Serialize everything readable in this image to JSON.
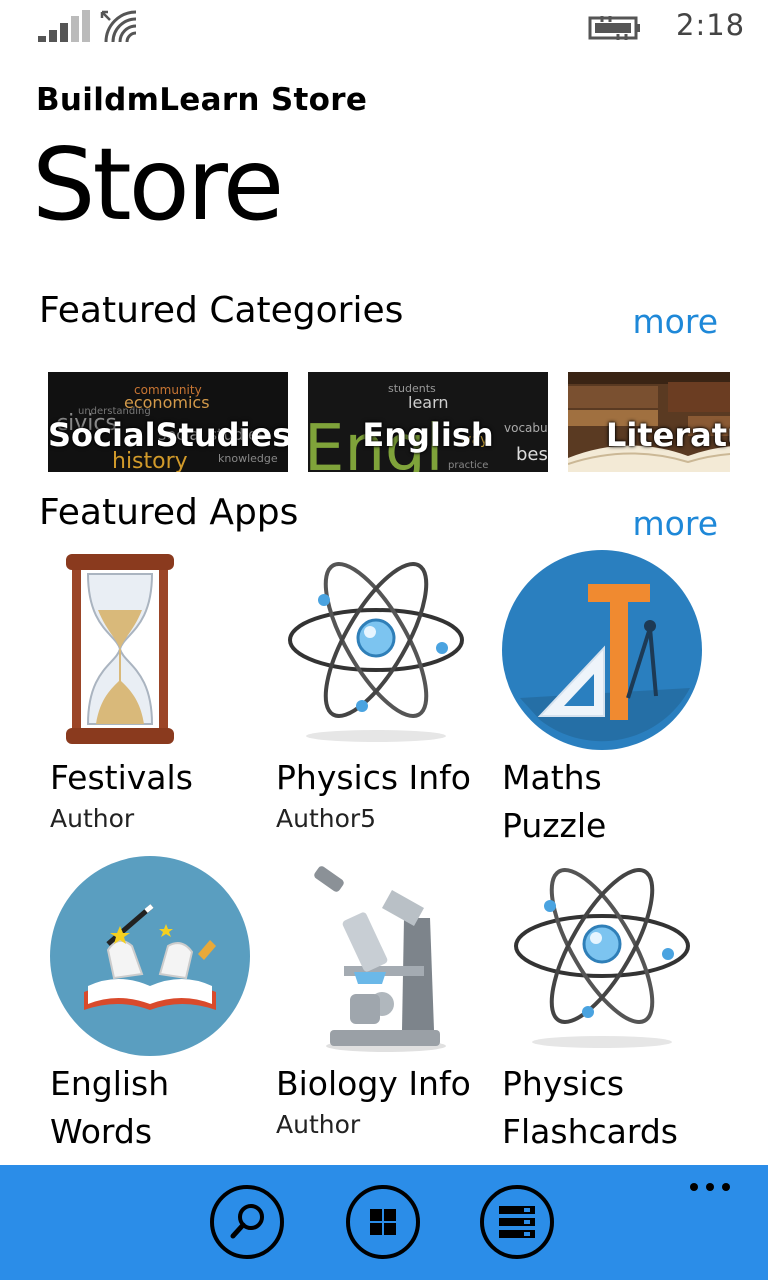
{
  "status_bar": {
    "time": "2:18",
    "icons": [
      "signal-icon",
      "wifi-icon",
      "battery-charging-icon"
    ]
  },
  "header": {
    "app_title": "BuildmLearn Store",
    "page_title": "Store"
  },
  "featured_categories": {
    "title": "Featured Categories",
    "more": "more",
    "items": [
      {
        "label": "SocialStudies"
      },
      {
        "label": "English"
      },
      {
        "label": "Literatu"
      }
    ]
  },
  "featured_apps": {
    "title": "Featured Apps",
    "more": "more",
    "items": [
      {
        "name": "Festivals",
        "author": "Author",
        "icon": "hourglass-icon"
      },
      {
        "name": "Physics Info",
        "author": "Author5",
        "icon": "atom-icon"
      },
      {
        "name": "Maths Puzzle",
        "name_line1": "Maths",
        "name_line2": "Puzzle",
        "author": "",
        "icon": "ruler-compass-icon"
      },
      {
        "name": "English Words",
        "name_line1": "English",
        "name_line2": "Words",
        "author": "",
        "icon": "magic-book-icon"
      },
      {
        "name": "Biology Info",
        "author": "Author",
        "icon": "microscope-icon"
      },
      {
        "name": "Physics Flashcards",
        "name_line1": "Physics",
        "name_line2": "Flashcards",
        "author": "",
        "icon": "atom-icon"
      }
    ]
  },
  "app_bar": {
    "buttons": [
      "search-icon",
      "apps-grid-icon",
      "list-icon"
    ],
    "accent": "#2b8de8"
  },
  "colors": {
    "link": "#1e88d8",
    "background": "#ffffff"
  }
}
